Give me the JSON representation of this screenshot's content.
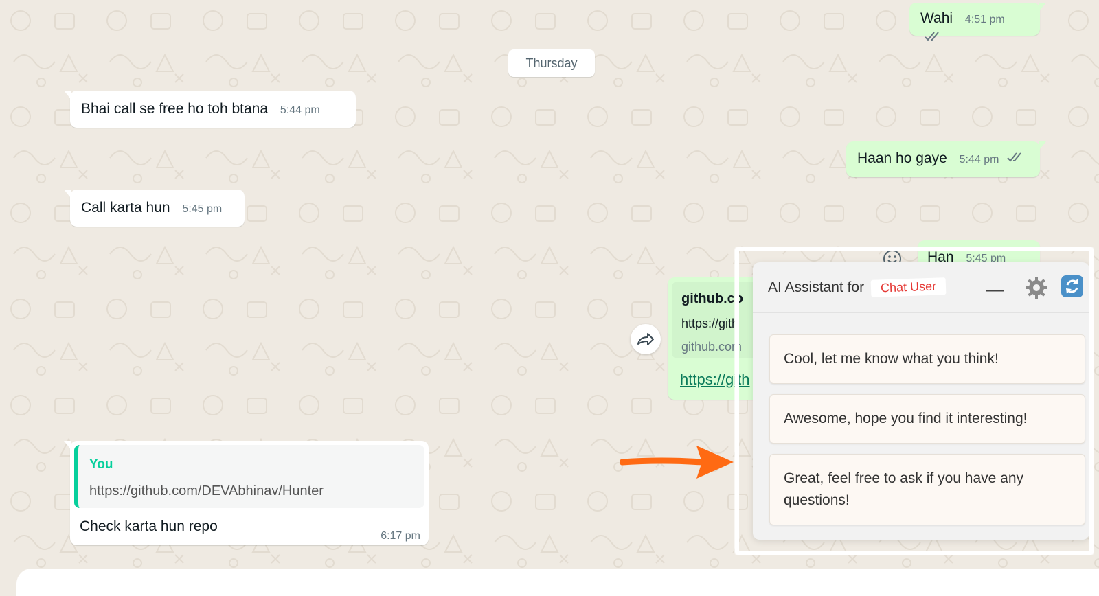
{
  "day_divider": "Thursday",
  "messages": {
    "m1": {
      "text": "Wahi",
      "time": "4:51 pm"
    },
    "m2": {
      "text": "Bhai call se free ho toh btana",
      "time": "5:44 pm"
    },
    "m3": {
      "text": "Haan ho gaye",
      "time": "5:44 pm"
    },
    "m4": {
      "text": "Call karta hun",
      "time": "5:45 pm"
    },
    "m5": {
      "text": "Han",
      "time": "5:45 pm"
    },
    "m6": {
      "preview_title": "github.co",
      "preview_url": "https://gith",
      "preview_domain": "github.com",
      "link": "https://gith"
    },
    "m7": {
      "quote_author": "You",
      "quote_text": "https://github.com/DEVAbhinav/Hunter",
      "text": "Check karta hun repo",
      "time": "6:17 pm"
    }
  },
  "ai_panel": {
    "title": "AI Assistant for",
    "user_label": "Chat User",
    "minimize": "—",
    "suggestions": [
      "Cool, let me know what you think!",
      "Awesome, hope you find it interesting!",
      "Great, feel free to ask if you have any questions!"
    ]
  },
  "colors": {
    "wallpaper": "#efeae2",
    "incoming": "#ffffff",
    "outgoing": "#d9fdd3",
    "read_ticks": "#667781",
    "quote_accent": "#06cf9c",
    "annotation_arrow": "#ff6a13",
    "user_label": "#e53935"
  }
}
